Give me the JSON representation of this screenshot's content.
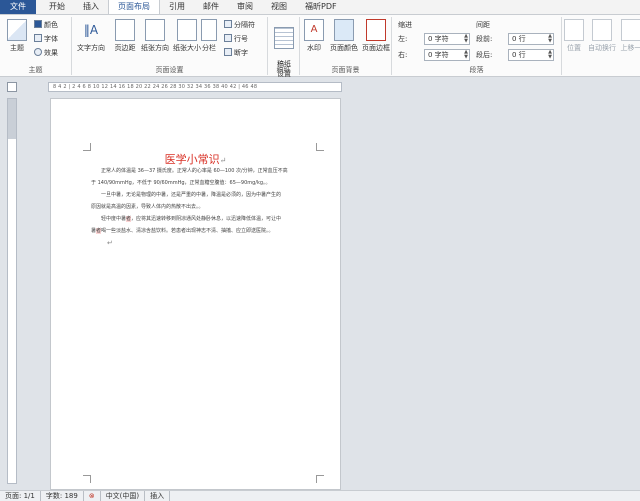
{
  "tabs": [
    "文件",
    "开始",
    "插入",
    "页面布局",
    "引用",
    "邮件",
    "审阅",
    "视图",
    "福昕PDF"
  ],
  "ribbon": {
    "theme": {
      "main_label": "主题",
      "colors_label": "颜色",
      "fonts_label": "字体",
      "effects_label": "效果",
      "group_label": "主题"
    },
    "page_setup": {
      "text_direction": "文字方向",
      "margins": "页边距",
      "orientation": "纸张方向",
      "size": "纸张大小",
      "columns": "分栏",
      "breaks": "分隔符",
      "line_numbers": "行号",
      "hyphenation": "断字",
      "group_label": "页面设置"
    },
    "draft": {
      "button": "稿纸\n设置",
      "group_label": "稿纸"
    },
    "page_background": {
      "watermark": "水印",
      "page_color": "页面颜色",
      "page_borders": "页面边框",
      "group_label": "页面背景"
    },
    "paragraph": {
      "indent_header": "缩进",
      "spacing_header": "间距",
      "left_label": "左:",
      "left_value": "0 字符",
      "right_label": "右:",
      "right_value": "0 字符",
      "before_label": "段前:",
      "before_value": "0 行",
      "after_label": "段后:",
      "after_value": "0 行",
      "group_label": "段落"
    },
    "arrange": {
      "position": "位置",
      "wrap_text": "自动换行",
      "bring_forward": "上移一"
    }
  },
  "ruler": {
    "ticks": "8  4  2  |  2  4  6  8  10 12 14 16 18 20 22 24 26 28 30 32 34 36 38 40 42 |  46  48"
  },
  "document": {
    "title": "医学小常识",
    "paragraph1": [
      "正常人的体温是 36—37 摄氏度。正常人的心率是 60—100 次/分钟，正常血压不高",
      "于 140/90mmHg，不低于 90/60mmHg，正常血糖空腹值：65—90mg/kg。。"
    ],
    "paragraph2": [
      "一旦中暑，无论是物理的中暑，还是严重的中暑，降温是必须的，因为中暑产生的",
      "原因就是高温的因素，导致人体内的热散不出去。。"
    ],
    "paragraph3_prefix": "轻中度中暑",
    "paragraph3_highlight": "者",
    "paragraph3_rest": "，应将其迅速转移到阴凉通风处静卧休息，以迅速降低体温，可让中",
    "paragraph3_line2_prefix": "暑",
    "paragraph3_line2_highlight": "者",
    "paragraph3_line2_rest": "喝一些淡盐水、清凉含盐饮料。若患者出现神志不清、抽搐、应立即送医院。。"
  },
  "status": {
    "page": "页面: 1/1",
    "words": "字数: 189",
    "language": "中文(中国)",
    "mode": "插入"
  }
}
